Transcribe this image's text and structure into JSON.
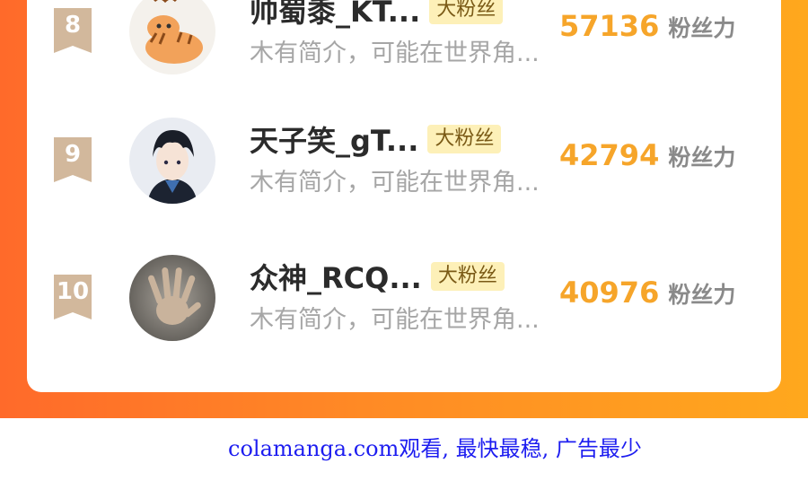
{
  "leaderboard": {
    "unit_label": "粉丝力",
    "rows": [
      {
        "rank": "8",
        "name": "帅蜀黍_KT...",
        "tag": "大粉丝",
        "intro": "木有简介，可能在世界角...",
        "score": "57136",
        "avatar_icon": "cartoon-tiger-avatar"
      },
      {
        "rank": "9",
        "name": "天子笑_gT...",
        "tag": "大粉丝",
        "intro": "木有简介，可能在世界角...",
        "score": "42794",
        "avatar_icon": "anime-boy-avatar"
      },
      {
        "rank": "10",
        "name": "众神_RCQ...",
        "tag": "大粉丝",
        "intro": "木有简介，可能在世界角...",
        "score": "40976",
        "avatar_icon": "hand-photo-avatar"
      }
    ]
  },
  "footer": {
    "text": "colamanga.com观看, 最快最稳, 广告最少"
  },
  "colors": {
    "background_start": "#ff6a2a",
    "background_end": "#ffa81d",
    "score": "#f6a52a",
    "rank_badge": "#d2b89c",
    "tag_bg": "#fdf0b8",
    "footer_text": "#1d1df0"
  }
}
